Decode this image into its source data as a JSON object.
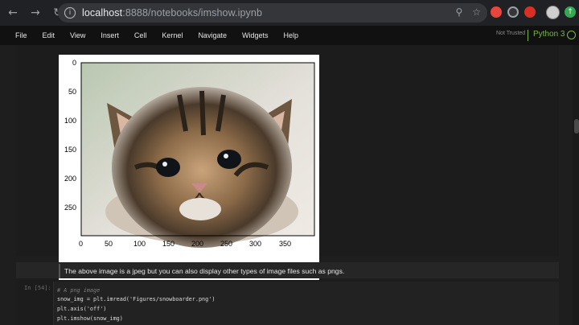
{
  "browser": {
    "url_host": "localhost",
    "url_path": ":8888/notebooks/imshow.ipynb",
    "ext_colors": [
      "#e8453c",
      "#9aa0a6",
      "#d93025"
    ]
  },
  "jupyter": {
    "menu": [
      "File",
      "Edit",
      "View",
      "Insert",
      "Cell",
      "Kernel",
      "Navigate",
      "Widgets",
      "Help"
    ],
    "trust_status": "Not Trusted",
    "kernel": "Python 3"
  },
  "figure": {
    "image_description": "photo of a tabby kitten",
    "y_ticks": [
      "0",
      "50",
      "100",
      "150",
      "200",
      "250"
    ],
    "x_ticks": [
      "0",
      "50",
      "100",
      "150",
      "200",
      "250",
      "300",
      "350"
    ]
  },
  "markdown": {
    "text": "The above image is a jpeg but you can also display other types of image files such as pngs."
  },
  "code_cell": {
    "prompt": "In [54]:",
    "lines": [
      "# A png image",
      "snow_img = plt.imread('Figures/snowboarder.png')",
      "plt.axis('off')",
      "plt.imshow(snow_img)"
    ]
  }
}
